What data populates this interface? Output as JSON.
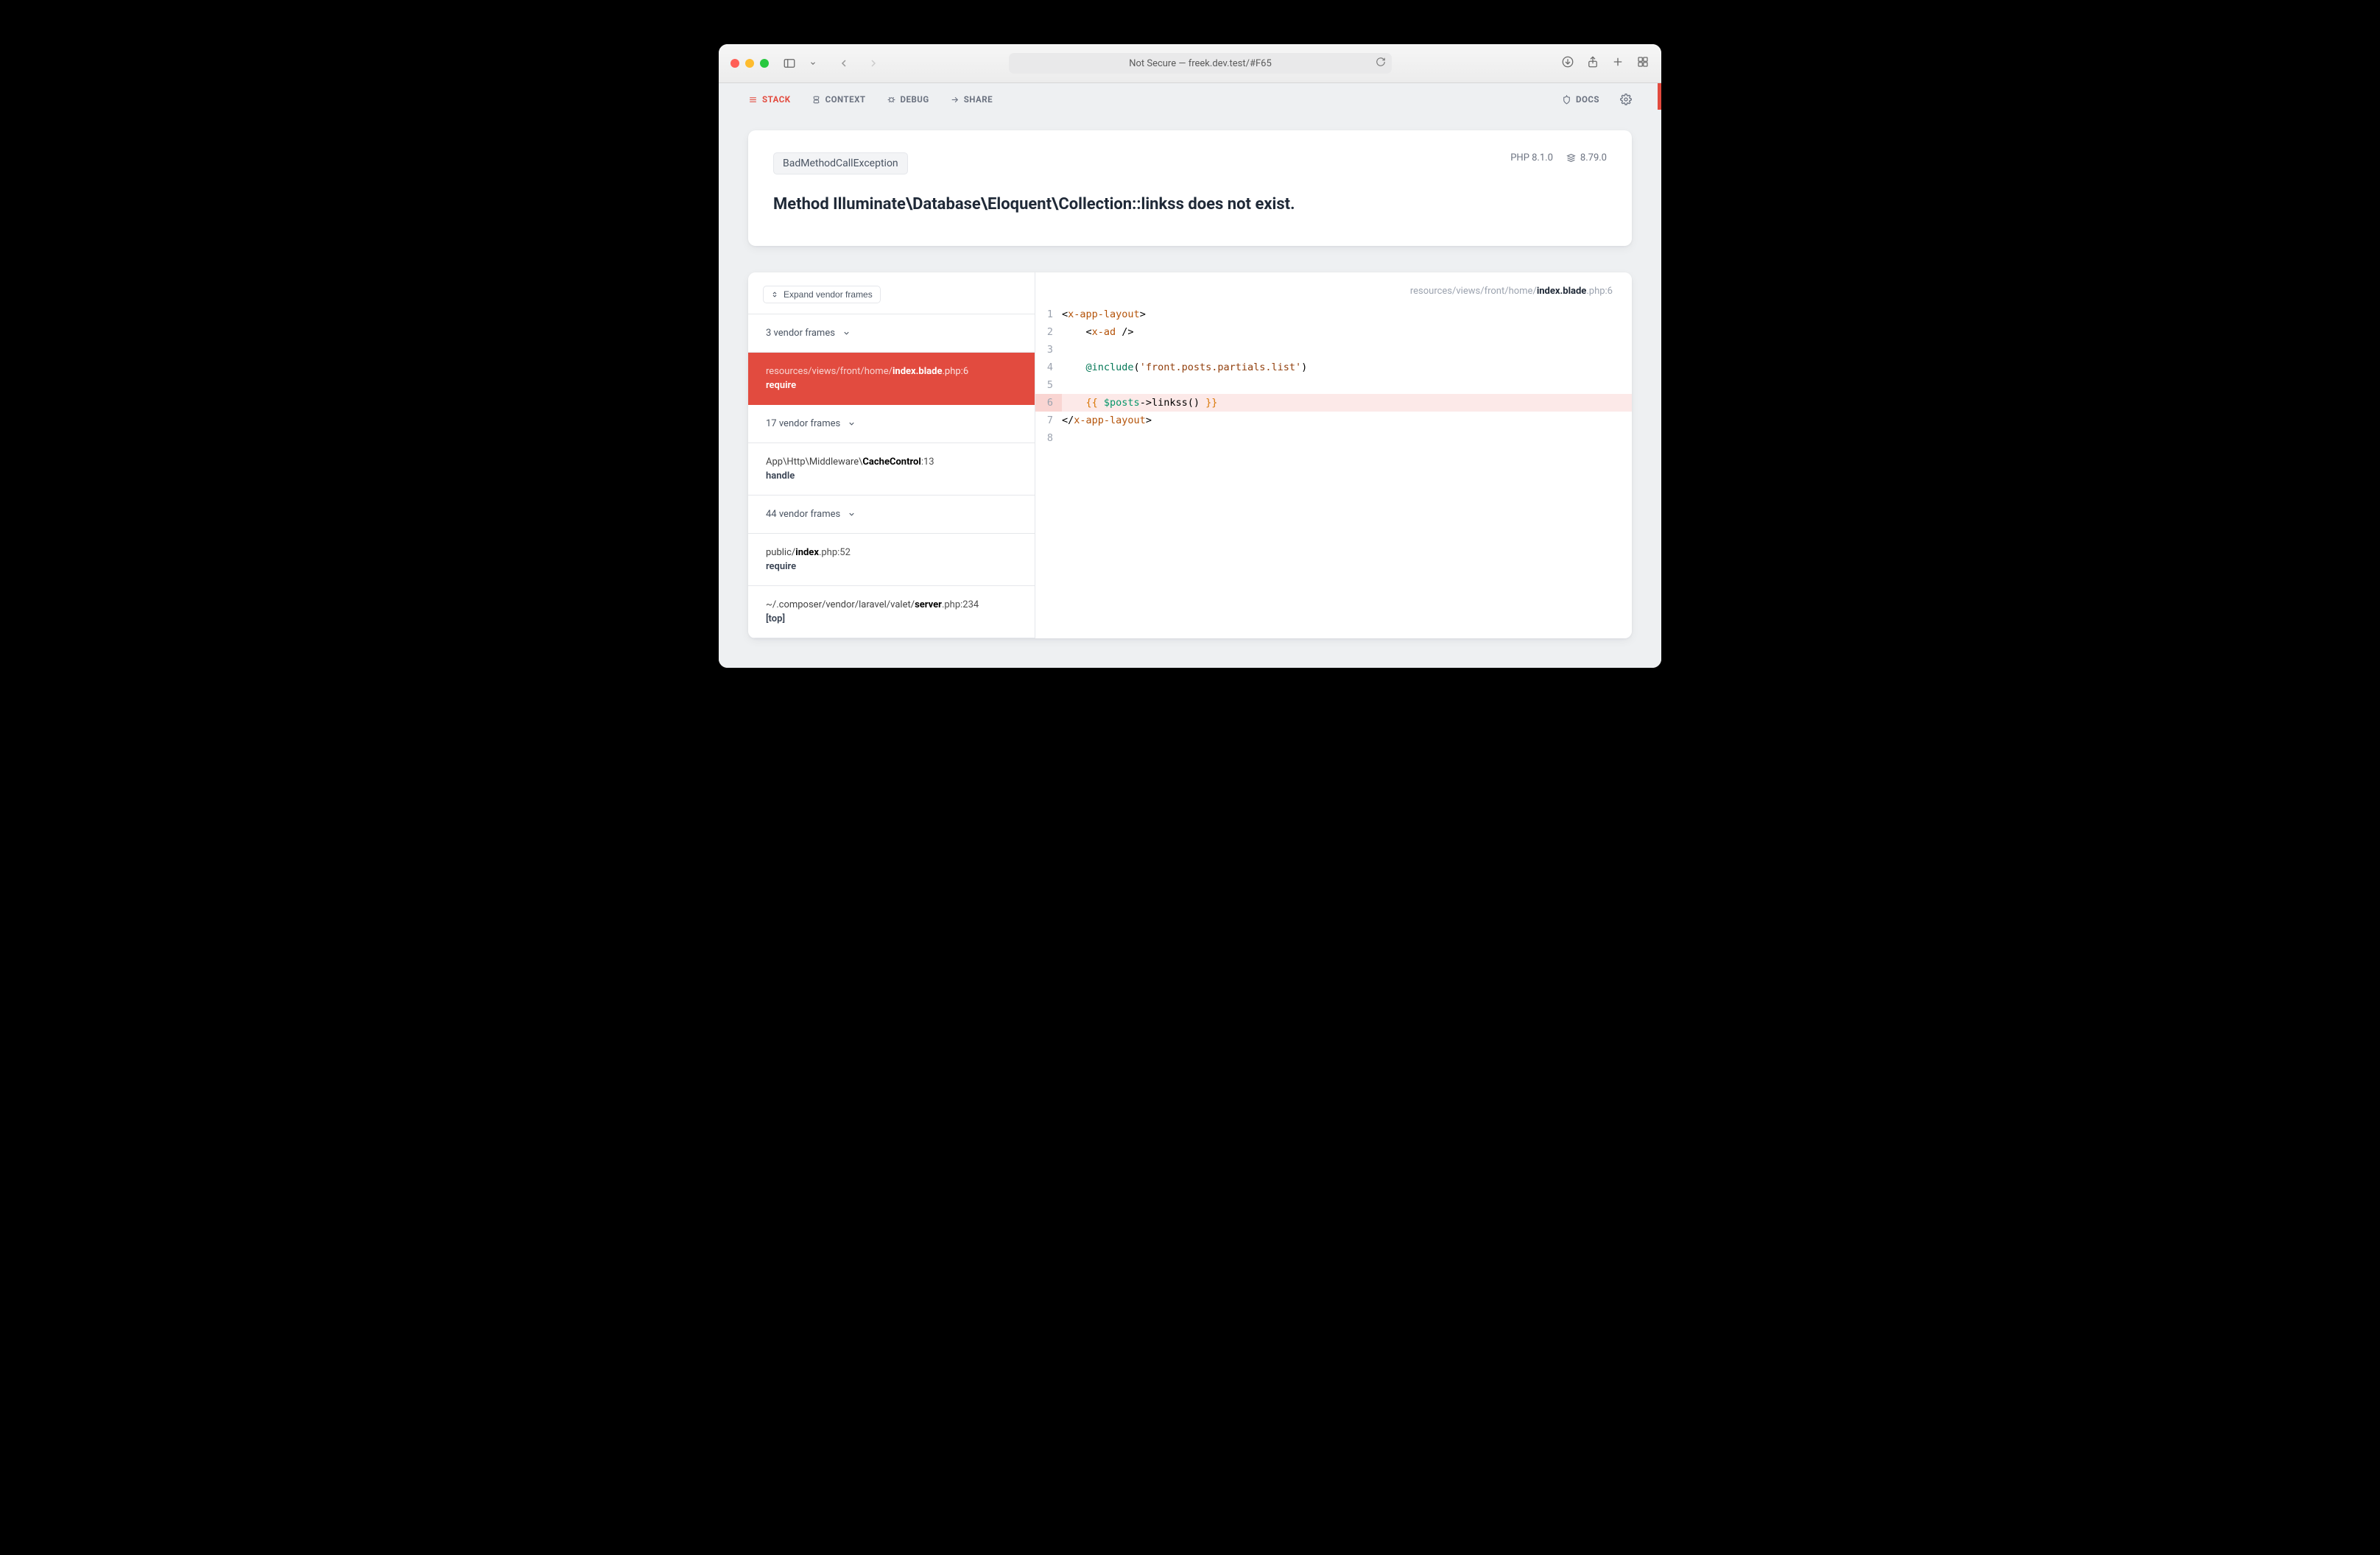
{
  "browser": {
    "address": "Not Secure — freek.dev.test/#F65"
  },
  "topnav": {
    "stack": "STACK",
    "context": "CONTEXT",
    "debug": "DEBUG",
    "share": "SHARE",
    "docs": "DOCS"
  },
  "hero": {
    "exception_badge": "BadMethodCallException",
    "title": "Method Illuminate\\Database\\Eloquent\\Collection::linkss does not exist.",
    "php_version": "PHP 8.1.0",
    "laravel_version": "8.79.0"
  },
  "frames": {
    "expand_label": "Expand vendor frames",
    "items": [
      {
        "type": "collapsed",
        "label": "3 vendor frames"
      },
      {
        "type": "active",
        "path_dim": "resources/views/front/home/",
        "path_base": "index.blade",
        "ext": ".php",
        "line": ":6",
        "method": "require"
      },
      {
        "type": "collapsed",
        "label": "17 vendor frames"
      },
      {
        "type": "frame",
        "path_dim": "App\\Http\\Middleware\\",
        "path_base": "CacheControl",
        "ext": "",
        "line": ":13",
        "method": "handle"
      },
      {
        "type": "collapsed",
        "label": "44 vendor frames"
      },
      {
        "type": "frame",
        "path_dim": "public/",
        "path_base": "index",
        "ext": ".php",
        "line": ":52",
        "method": "require"
      },
      {
        "type": "frame",
        "path_dim": "~/.composer/vendor/laravel/valet/",
        "path_base": "server",
        "ext": ".php",
        "line": ":234",
        "method": "[top]"
      }
    ]
  },
  "code": {
    "path_dim": "resources/views/front/home/",
    "path_base": "index.blade",
    "path_ext": ".php",
    "path_line": ":6",
    "lines": [
      {
        "n": 1,
        "html": "&lt;<span class=\"tok-tag\">x-app-layout</span>&gt;"
      },
      {
        "n": 2,
        "html": "    &lt;<span class=\"tok-tag\">x-ad</span> /&gt;"
      },
      {
        "n": 3,
        "html": ""
      },
      {
        "n": 4,
        "html": "    <span class=\"tok-include\">@include</span>(<span class=\"tok-str\">'front.posts.partials.list'</span>)"
      },
      {
        "n": 5,
        "html": ""
      },
      {
        "n": 6,
        "hl": true,
        "html": "    <span class=\"tok-brace\">{{</span> <span class=\"tok-var\">$posts</span>-&gt;linkss() <span class=\"tok-brace\">}}</span>"
      },
      {
        "n": 7,
        "html": "&lt;/<span class=\"tok-tag\">x-app-layout</span>&gt;"
      },
      {
        "n": 8,
        "html": ""
      }
    ]
  }
}
